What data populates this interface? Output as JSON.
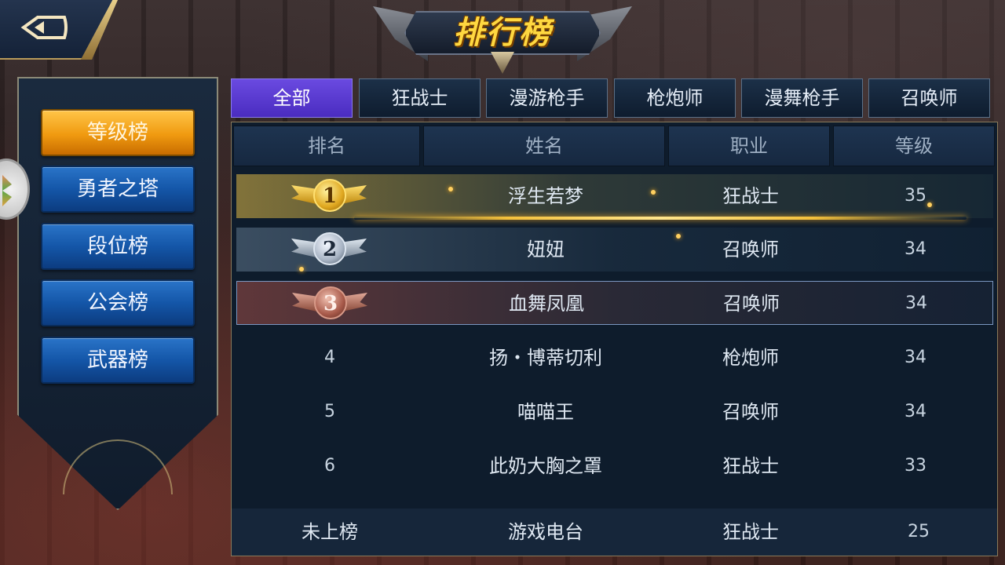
{
  "title": "排行榜",
  "back": {
    "icon": "back-arrow-icon"
  },
  "sidebar": {
    "items": [
      {
        "label": "等级榜",
        "active": true
      },
      {
        "label": "勇者之塔",
        "active": false
      },
      {
        "label": "段位榜",
        "active": false
      },
      {
        "label": "公会榜",
        "active": false
      },
      {
        "label": "武器榜",
        "active": false
      }
    ]
  },
  "tabs": [
    {
      "label": "全部",
      "active": true
    },
    {
      "label": "狂战士",
      "active": false
    },
    {
      "label": "漫游枪手",
      "active": false
    },
    {
      "label": "枪炮师",
      "active": false
    },
    {
      "label": "漫舞枪手",
      "active": false
    },
    {
      "label": "召唤师",
      "active": false
    }
  ],
  "table": {
    "headers": [
      "排名",
      "姓名",
      "职业",
      "等级"
    ],
    "rows": [
      {
        "rank": "1",
        "name": "浮生若梦",
        "class": "狂战士",
        "level": "35"
      },
      {
        "rank": "2",
        "name": "妞妞",
        "class": "召唤师",
        "level": "34"
      },
      {
        "rank": "3",
        "name": "血舞凤凰",
        "class": "召唤师",
        "level": "34"
      },
      {
        "rank": "4",
        "name": "扬・博蒂切利",
        "class": "枪炮师",
        "level": "34"
      },
      {
        "rank": "5",
        "name": "喵喵王",
        "class": "召唤师",
        "level": "34"
      },
      {
        "rank": "6",
        "name": "此奶大胸之罩",
        "class": "狂战士",
        "level": "33"
      }
    ],
    "self_row": {
      "rank": "未上榜",
      "name": "游戏电台",
      "class": "狂战士",
      "level": "25"
    }
  },
  "colors": {
    "active_side": "#f09a10",
    "side_button": "#1456a8",
    "active_tab": "#5a3ad0",
    "gold": "#e0a820",
    "silver": "#a8b4c4",
    "bronze": "#a85a4a"
  }
}
